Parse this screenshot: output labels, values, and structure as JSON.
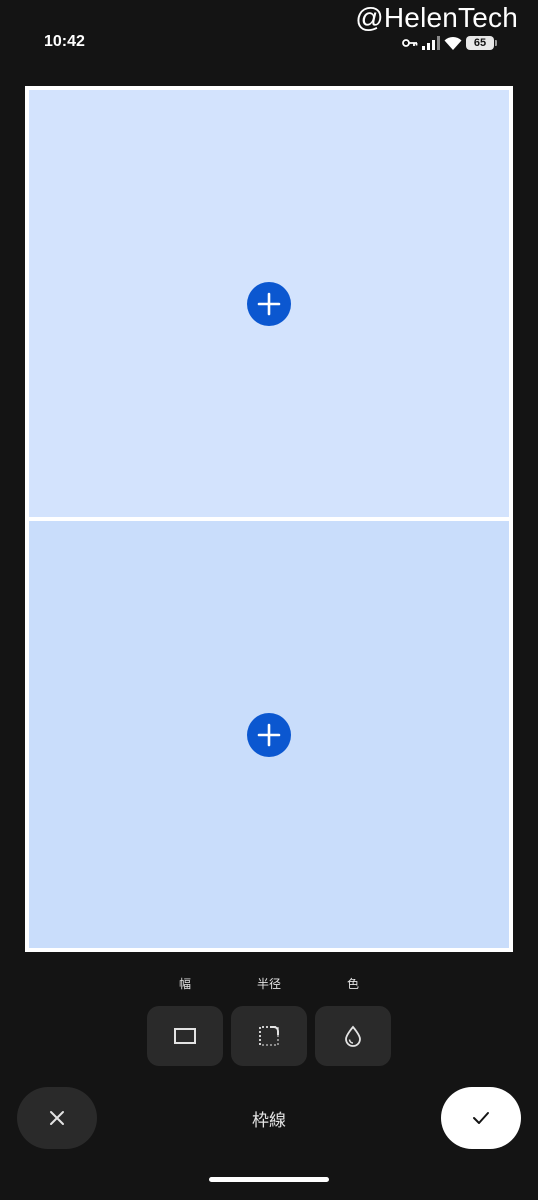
{
  "watermark": "@HelenTech",
  "status_bar": {
    "time": "10:42",
    "battery": "65",
    "icons": [
      "key-icon",
      "signal-icon",
      "wifi-icon",
      "battery-icon"
    ]
  },
  "collage": {
    "cells": [
      {
        "icon": "add-photo-icon"
      },
      {
        "icon": "add-photo-icon"
      }
    ]
  },
  "border_tools": {
    "items": [
      {
        "label": "幅",
        "icon": "border-width-icon"
      },
      {
        "label": "半径",
        "icon": "corner-radius-icon"
      },
      {
        "label": "色",
        "icon": "color-drop-icon"
      }
    ]
  },
  "bottom_bar": {
    "title": "枠線",
    "cancel_icon": "close-icon",
    "confirm_icon": "check-icon"
  },
  "colors": {
    "background": "#141414",
    "cell_top": "#d3e3fd",
    "cell_bottom": "#c9ddfb",
    "accent": "#0b57d0",
    "tool_button": "#2a2a2a"
  }
}
